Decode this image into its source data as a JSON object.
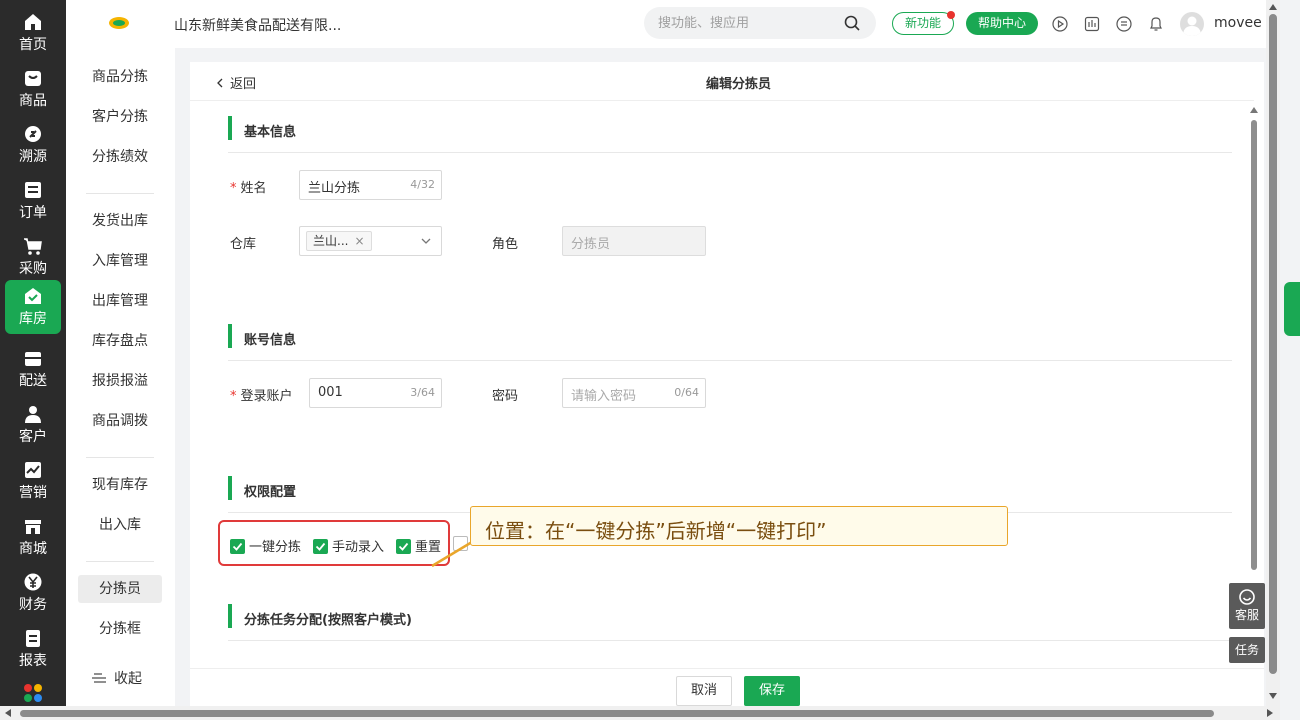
{
  "colors": {
    "brand_green": "#1aa853",
    "dark_sidebar": "#2b2b2b",
    "highlight_red": "#e03a3a",
    "callout_border": "#e9a62b"
  },
  "iconbar": {
    "items": [
      {
        "label": "首页",
        "icon": "home-icon"
      },
      {
        "label": "商品",
        "icon": "goods-icon"
      },
      {
        "label": "溯源",
        "icon": "trace-icon"
      },
      {
        "label": "订单",
        "icon": "order-icon"
      },
      {
        "label": "采购",
        "icon": "cart-icon"
      },
      {
        "label": "库房",
        "icon": "warehouse-icon"
      },
      {
        "label": "配送",
        "icon": "delivery-icon"
      },
      {
        "label": "客户",
        "icon": "customer-icon"
      },
      {
        "label": "营销",
        "icon": "marketing-icon"
      },
      {
        "label": "商城",
        "icon": "mall-icon"
      },
      {
        "label": "财务",
        "icon": "finance-icon"
      },
      {
        "label": "报表",
        "icon": "report-icon"
      }
    ]
  },
  "subnav": {
    "items": [
      "商品分拣",
      "客户分拣",
      "分拣绩效",
      "发货出库",
      "入库管理",
      "出库管理",
      "库存盘点",
      "报损报溢",
      "商品调拨",
      "现有库存",
      "出入库",
      "分拣员",
      "分拣框"
    ],
    "collapse": "收起"
  },
  "header": {
    "company": "山东新鲜美食品配送有限...",
    "search_placeholder": "搜功能、搜应用",
    "new_feature": "新功能",
    "help": "帮助中心",
    "username": "movee"
  },
  "page": {
    "back": "返回",
    "title": "编辑分拣员"
  },
  "basic": {
    "title": "基本信息",
    "name_label": "姓名",
    "name_value": "兰山分拣",
    "name_count": "4/32",
    "warehouse_label": "仓库",
    "warehouse_tag": "兰山...",
    "tag_remove": "×",
    "role_label": "角色",
    "role_value": "分拣员"
  },
  "account": {
    "title": "账号信息",
    "login_label": "登录账户",
    "login_value": "001",
    "login_count": "3/64",
    "password_label": "密码",
    "password_placeholder": "请输入密码",
    "password_count": "0/64"
  },
  "permissions": {
    "title": "权限配置",
    "items": [
      {
        "label": "一键分拣",
        "checked": true
      },
      {
        "label": "手动录入",
        "checked": true
      },
      {
        "label": "重置",
        "checked": true
      },
      {
        "label": "",
        "checked": false
      }
    ]
  },
  "callout": "位置：在“一键分拣”后新增“一键打印”",
  "task": {
    "title": "分拣任务分配(按照客户模式)"
  },
  "footer": {
    "cancel": "取消",
    "save": "保存"
  },
  "floating": {
    "service": "客服",
    "task": "任务"
  }
}
